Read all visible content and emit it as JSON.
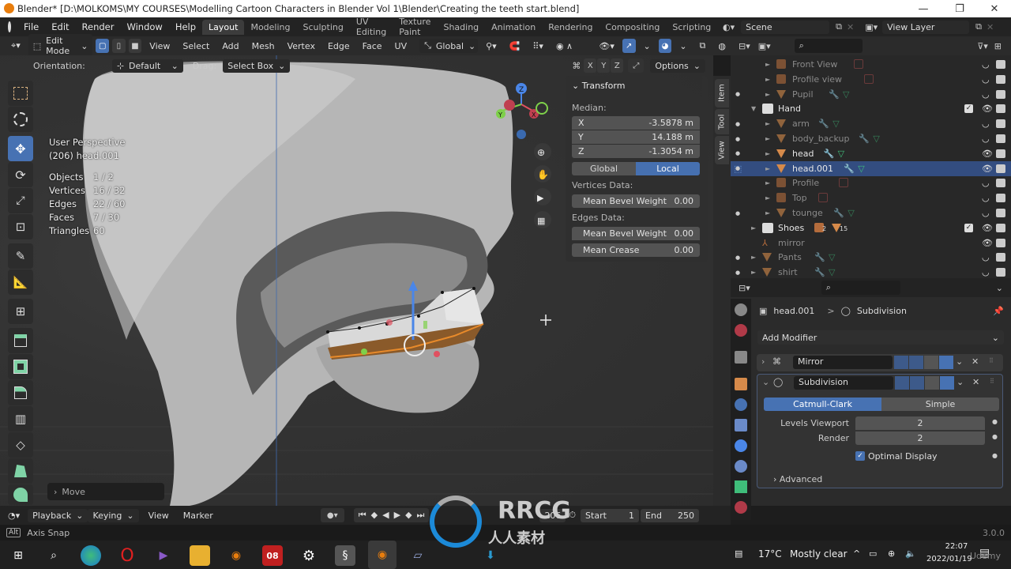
{
  "window": {
    "title": "Blender* [D:\\MOLKOMS\\MY COURSES\\Modelling  Cartoon Characters in Blender Vol 1\\Blender\\Creating the teeth start.blend]",
    "controls": {
      "minimize": "—",
      "maximize": "❐",
      "close": "✕"
    }
  },
  "menu": [
    "File",
    "Edit",
    "Render",
    "Window",
    "Help"
  ],
  "workspaces": [
    "Layout",
    "Modeling",
    "Sculpting",
    "UV Editing",
    "Texture Paint",
    "Shading",
    "Animation",
    "Rendering",
    "Compositing",
    "Scripting"
  ],
  "active_workspace": "Layout",
  "add_workspace": "+",
  "scene": {
    "label": "Scene",
    "view_layer": "View Layer"
  },
  "header": {
    "mode": "Edit Mode",
    "items": [
      "View",
      "Select",
      "Add",
      "Mesh",
      "Vertex",
      "Edge",
      "Face",
      "UV"
    ],
    "transform_orientation": "Global",
    "axes": [
      "X",
      "Y",
      "Z"
    ],
    "options": "Options"
  },
  "tool_settings": {
    "orientation_label": "Orientation:",
    "orientation_value": "Default",
    "drag_label": "Drag:",
    "drag_value": "Select Box"
  },
  "viewport": {
    "perspective": "User Perspective",
    "object": "(206) head.001",
    "stats": [
      {
        "label": "Objects",
        "value": "1 / 2"
      },
      {
        "label": "Vertices",
        "value": "16 / 32"
      },
      {
        "label": "Edges",
        "value": "22 / 60"
      },
      {
        "label": "Faces",
        "value": "7 / 30"
      },
      {
        "label": "Triangles",
        "value": "60"
      }
    ],
    "gizmo_axes": [
      "Z",
      "Y",
      "X"
    ],
    "last_operator": "Move"
  },
  "npanel": {
    "section": "Transform",
    "median_label": "Median:",
    "x": {
      "label": "X",
      "value": "-3.5878 m"
    },
    "y": {
      "label": "Y",
      "value": "14.188 m"
    },
    "z": {
      "label": "Z",
      "value": "-1.3054 m"
    },
    "space": {
      "global": "Global",
      "local": "Local",
      "active": "Local"
    },
    "vertices_data": "Vertices Data:",
    "v_bevel": {
      "label": "Mean Bevel Weight",
      "value": "0.00"
    },
    "edges_data": "Edges Data:",
    "e_bevel": {
      "label": "Mean Bevel Weight",
      "value": "0.00"
    },
    "e_crease": {
      "label": "Mean Crease",
      "value": "0.00"
    },
    "tabs": [
      "Item",
      "Tool",
      "View"
    ]
  },
  "outliner": {
    "rows": [
      {
        "name": "Front View",
        "type": "image",
        "dim": true
      },
      {
        "name": "Profile view",
        "type": "image",
        "dim": true
      },
      {
        "name": "Pupil",
        "type": "mesh",
        "dim": true
      },
      {
        "name": "Hand",
        "type": "collection",
        "dim": false
      },
      {
        "name": "arm",
        "type": "mesh",
        "dim": true
      },
      {
        "name": "body_backup",
        "type": "mesh",
        "dim": true
      },
      {
        "name": "head",
        "type": "mesh",
        "dim": false
      },
      {
        "name": "head.001",
        "type": "mesh",
        "dim": false,
        "selected": true
      },
      {
        "name": "Profile",
        "type": "image",
        "dim": true
      },
      {
        "name": "Top",
        "type": "image",
        "dim": true
      },
      {
        "name": "tounge",
        "type": "mesh",
        "dim": true
      },
      {
        "name": "Shoes",
        "type": "collection",
        "dim": false,
        "badges": [
          "2",
          "15"
        ]
      },
      {
        "name": "mirror",
        "type": "empty",
        "dim": true
      },
      {
        "name": "Pants",
        "type": "mesh",
        "dim": true
      },
      {
        "name": "shirt",
        "type": "mesh",
        "dim": true
      }
    ]
  },
  "properties": {
    "breadcrumb_object": "head.001",
    "breadcrumb_sep": ">",
    "breadcrumb_modifier": "Subdivision",
    "add_modifier": "Add Modifier",
    "modifiers": [
      {
        "name": "Mirror",
        "expanded": false
      },
      {
        "name": "Subdivision",
        "expanded": true
      }
    ],
    "subdivision": {
      "types": [
        "Catmull-Clark",
        "Simple"
      ],
      "active_type": "Catmull-Clark",
      "levels_viewport_label": "Levels Viewport",
      "levels_viewport": "2",
      "render_label": "Render",
      "render": "2",
      "optimal_display_label": "Optimal Display",
      "optimal_display": true,
      "advanced": "Advanced"
    }
  },
  "timeline": {
    "menus": [
      "Playback",
      "Keying",
      "View",
      "Marker"
    ],
    "current_frame": "206",
    "start_label": "Start",
    "start": "1",
    "end_label": "End",
    "end": "250"
  },
  "statusbar": {
    "key": "Alt",
    "hint": "Axis Snap",
    "version": "3.0.0"
  },
  "taskbar": {
    "weather_temp": "17°C",
    "weather_desc": "Mostly clear",
    "time": "22:07",
    "date": "2022/01/19",
    "calendar_badge": "08"
  },
  "watermark": {
    "brand": "RRCG",
    "sub": "人人素材",
    "corner": "Udemy"
  },
  "colors": {
    "accent": "#4772b3",
    "selected_row": "#334d80",
    "mesh_orange": "#d68a4a",
    "data_green": "#3fbd7a"
  }
}
